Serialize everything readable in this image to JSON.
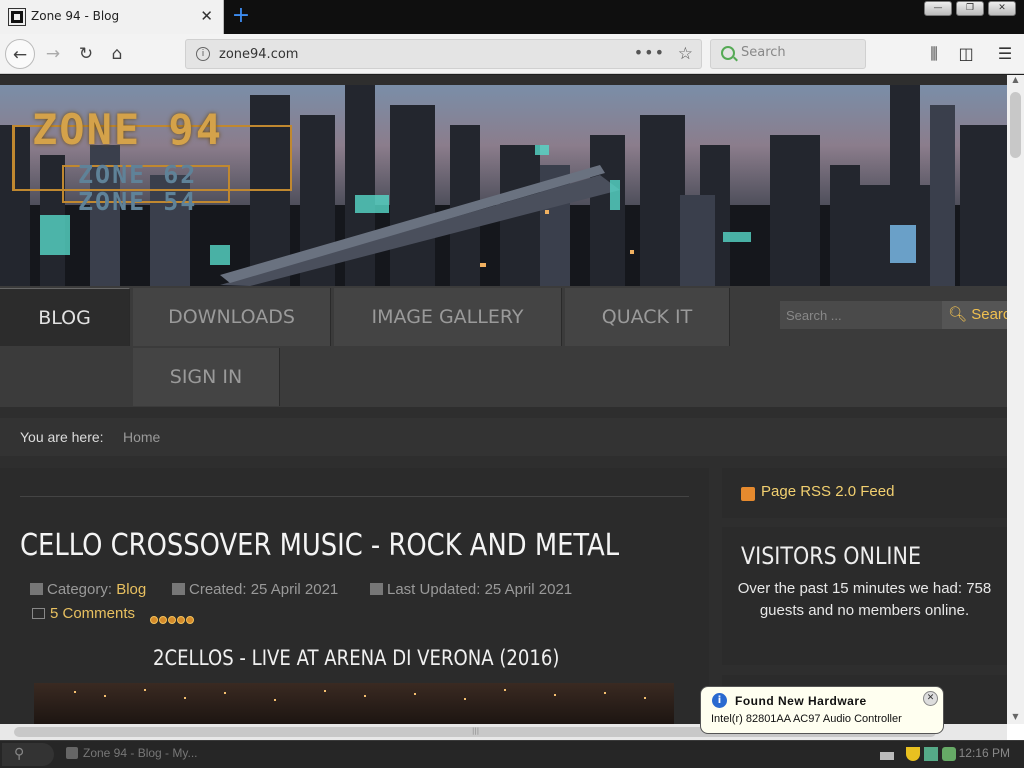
{
  "browser": {
    "tab_title": "Zone 94 - Blog",
    "tab_close": "✕",
    "new_tab": "+",
    "url": "zone94.com",
    "search_placeholder": "Search",
    "window_minimize": "—",
    "window_restore": "❐",
    "window_close": "✕"
  },
  "site": {
    "logo_main": "ZONE 94",
    "logo_sub1": "ZONE 62",
    "logo_sub2": "ZONE 54",
    "menu": [
      {
        "label": "BLOG",
        "active": true
      },
      {
        "label": "DOWNLOADS"
      },
      {
        "label": "IMAGE GALLERY"
      },
      {
        "label": "QUACK IT"
      },
      {
        "label": "SIGN IN"
      }
    ],
    "search_placeholder": "Search ...",
    "search_button": "Searc"
  },
  "breadcrumb": {
    "label": "You are here:",
    "home": "Home"
  },
  "article": {
    "title": "CELLO CROSSOVER MUSIC - ROCK AND METAL",
    "category_label": "Category:",
    "category": "Blog",
    "created": "Created: 25 April 2021",
    "updated": "Last Updated: 25 April 2021",
    "comments": "5 Comments",
    "rating_stars": 5,
    "subtitle": "2CELLOS - LIVE AT ARENA DI VERONA (2016)"
  },
  "sidebar": {
    "rss": "Page RSS 2.0 Feed",
    "visitors_title": "VISITORS ONLINE",
    "visitors_text": "Over the past 15 minutes we had: 758 guests and no members online."
  },
  "notification": {
    "title": "Found New Hardware",
    "body": "Intel(r) 82801AA AC97 Audio Controller",
    "close": "✕"
  },
  "taskbar": {
    "task": "Zone 94 - Blog - My...",
    "clock": "12:16 PM"
  }
}
